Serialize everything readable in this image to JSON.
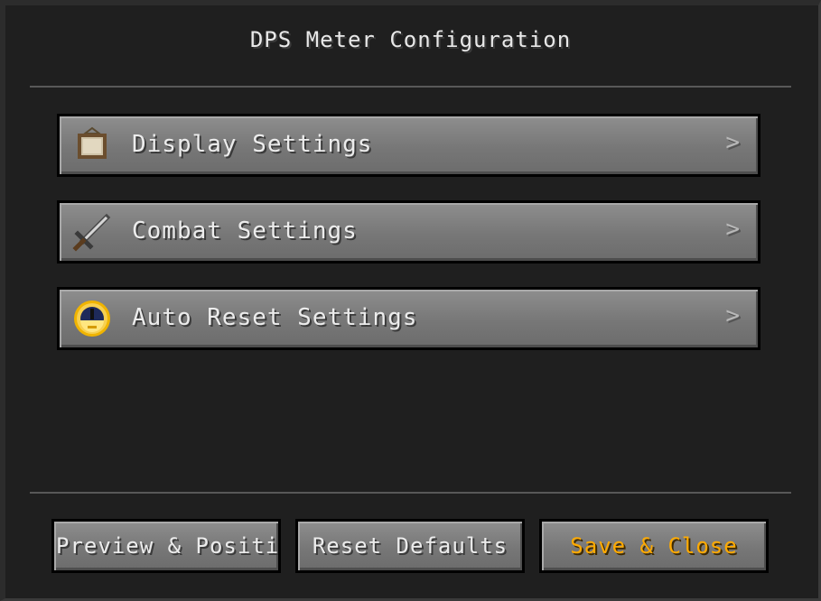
{
  "window": {
    "title": "DPS Meter Configuration"
  },
  "menu": {
    "items": [
      {
        "label": "Display Settings",
        "icon": "painting-icon",
        "chevron": ">"
      },
      {
        "label": "Combat Settings",
        "icon": "sword-icon",
        "chevron": ">"
      },
      {
        "label": "Auto Reset Settings",
        "icon": "clock-icon",
        "chevron": ">"
      }
    ]
  },
  "footer": {
    "preview_label": "Preview & Positic",
    "reset_label": "Reset Defaults",
    "save_label": "Save & Close"
  },
  "colors": {
    "background": "#1f1f1f",
    "button": "#777777",
    "text": "#ececec",
    "accent": "#ffaa00"
  }
}
